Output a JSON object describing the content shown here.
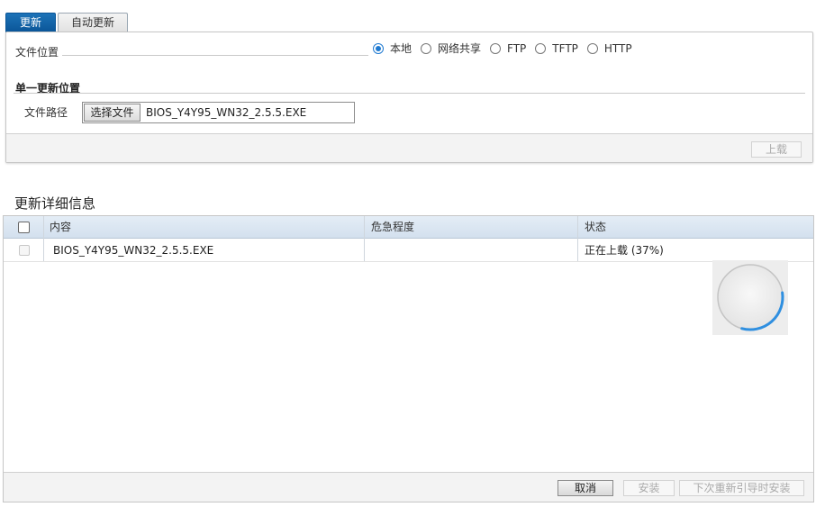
{
  "tabs": [
    {
      "label": "更新",
      "active": true
    },
    {
      "label": "自动更新",
      "active": false
    }
  ],
  "upload_panel": {
    "location_label": "文件位置",
    "location_options": [
      {
        "label": "本地",
        "checked": true
      },
      {
        "label": "网络共享",
        "checked": false
      },
      {
        "label": "FTP",
        "checked": false
      },
      {
        "label": "TFTP",
        "checked": false
      },
      {
        "label": "HTTP",
        "checked": false
      }
    ],
    "section_title": "单一更新位置",
    "path_label": "文件路径",
    "choose_file_label": "选择文件",
    "file_name": "BIOS_Y4Y95_WN32_2.5.5.EXE",
    "upload_label": "上载"
  },
  "details": {
    "title": "更新详细信息",
    "columns": [
      "内容",
      "危急程度",
      "状态"
    ],
    "rows": [
      {
        "content": "BIOS_Y4Y95_WN32_2.5.5.EXE",
        "criticality": "",
        "status": "正在上载 (37%)"
      }
    ],
    "upload_progress": 0.37,
    "cancel_label": "取消",
    "install_label": "安装",
    "install_next_reboot_label": "下次重新引导时安装"
  },
  "colors": {
    "tab_active": "#0a5597",
    "radio_accent": "#1f7ad1",
    "table_header": "#d3e0ee",
    "spinner_arc": "#2f8fe0"
  }
}
